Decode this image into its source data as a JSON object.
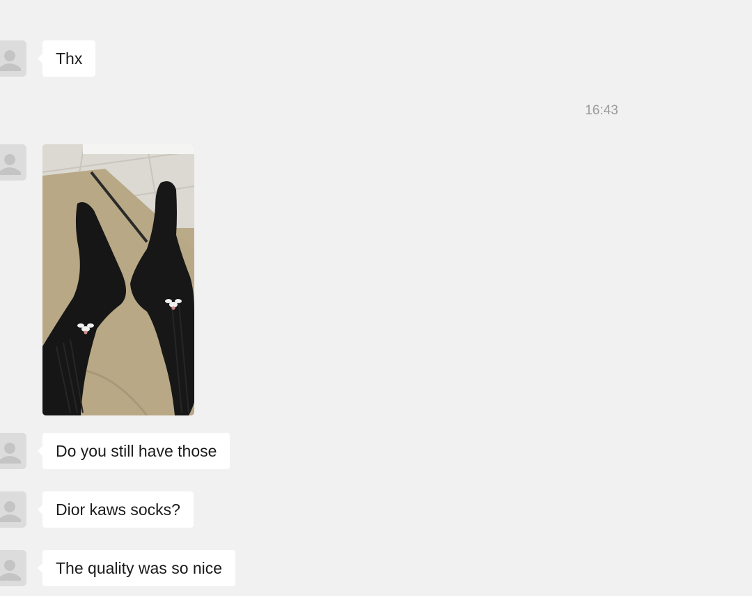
{
  "chat": {
    "messages": [
      {
        "type": "text",
        "text": "Thx"
      },
      {
        "type": "timestamp",
        "text": "16:43"
      },
      {
        "type": "image",
        "description_icon": "photo-icon"
      },
      {
        "type": "text",
        "text": "Do you still have those"
      },
      {
        "type": "text",
        "text": "Dior kaws socks?"
      },
      {
        "type": "text",
        "text": "The quality was so nice"
      }
    ]
  },
  "colors": {
    "background": "#f1f1f1",
    "bubble": "#ffffff",
    "avatar": "#dcdcdc",
    "timestamp": "#9a9a9a"
  }
}
